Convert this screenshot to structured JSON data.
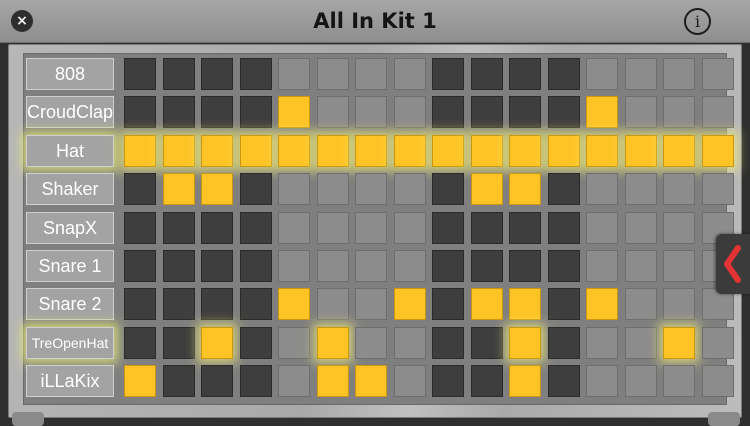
{
  "window": {
    "title": "All In Kit 1"
  },
  "buttons": {
    "close": "×",
    "info": "i"
  },
  "tracks": [
    {
      "name": "808",
      "steps": [
        0,
        0,
        0,
        0,
        0,
        0,
        0,
        0,
        0,
        0,
        0,
        0,
        0,
        0,
        0,
        0
      ]
    },
    {
      "name": "CroudClap",
      "steps": [
        0,
        0,
        0,
        0,
        1,
        0,
        0,
        0,
        0,
        0,
        0,
        0,
        1,
        0,
        0,
        0
      ]
    },
    {
      "name": "Hat",
      "steps": [
        1,
        1,
        1,
        1,
        1,
        1,
        1,
        1,
        1,
        1,
        1,
        1,
        1,
        1,
        1,
        1
      ]
    },
    {
      "name": "Shaker",
      "steps": [
        0,
        1,
        1,
        0,
        0,
        0,
        0,
        0,
        0,
        1,
        1,
        0,
        0,
        0,
        0,
        0
      ]
    },
    {
      "name": "SnapX",
      "steps": [
        0,
        0,
        0,
        0,
        0,
        0,
        0,
        0,
        0,
        0,
        0,
        0,
        0,
        0,
        0,
        0
      ]
    },
    {
      "name": "Snare 1",
      "steps": [
        0,
        0,
        0,
        0,
        0,
        0,
        0,
        0,
        0,
        0,
        0,
        0,
        0,
        0,
        0,
        0
      ]
    },
    {
      "name": "Snare 2",
      "steps": [
        0,
        0,
        0,
        0,
        1,
        0,
        0,
        1,
        0,
        1,
        1,
        0,
        1,
        0,
        0,
        0
      ]
    },
    {
      "name": "TreOpenHat",
      "steps": [
        0,
        0,
        1,
        0,
        0,
        1,
        0,
        0,
        0,
        0,
        1,
        0,
        0,
        0,
        1,
        0
      ]
    },
    {
      "name": "iLLaKix",
      "steps": [
        1,
        0,
        0,
        0,
        0,
        1,
        1,
        0,
        0,
        0,
        1,
        0,
        0,
        0,
        0,
        0
      ]
    }
  ],
  "step_group_shades": [
    "dark",
    "light",
    "dark",
    "light"
  ],
  "glow_tracks": [
    "Hat",
    "TreOpenHat"
  ],
  "colors": {
    "on": "#fec426",
    "off_dark": "#3e3e3e",
    "off_light": "#8c8c8c",
    "collapse_arrow": "#e33333"
  },
  "icons": {
    "close": "close-icon",
    "info": "info-icon",
    "collapse": "chevron-left-icon"
  }
}
